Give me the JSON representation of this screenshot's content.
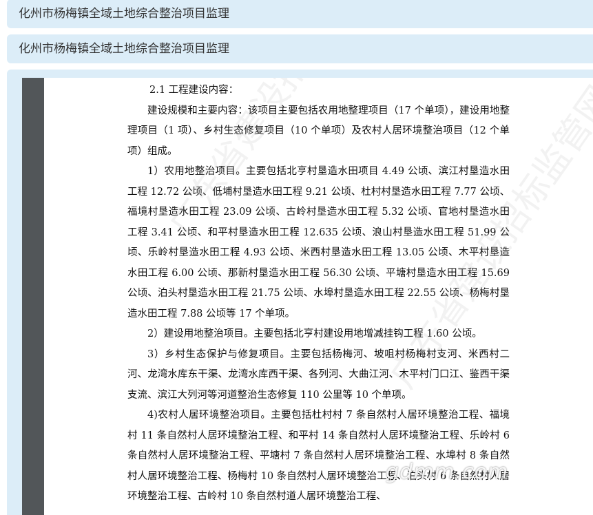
{
  "header": {
    "title_1": "化州市杨梅镇全域土地综合整治项目监理",
    "title_2": "化州市杨梅镇全域土地综合整治项目监理"
  },
  "document": {
    "section_heading": "2.1 工程建设内容：",
    "paragraphs": [
      "建设规模和主要内容：该项目主要包括农用地整理项目（17 个单项），建设用地整理项目（1 项）、乡村生态修复项目（10 个单项）及农村人居环境整治项目（12 个单项）组成。",
      "1）农用地整治项目。主要包括北亨村垦造水田项目 4.49 公顷、滨江村垦造水田工程 12.72 公顷、低埔村垦造水田工程 9.21 公顷、杜村村垦造水田工程 7.77 公顷、福境村垦造水田工程 23.09 公顷、古岭村垦造水田工程 5.32 公顷、官地村垦造水田工程 3.41 公顷、和平村垦造水田工程 12.635 公顷、浪山村垦造水田工程 51.99 公顷、乐岭村垦造水田工程 4.93 公顷、米西村垦造水田工程 13.05 公顷、木平村垦造水田工程 6.00 公顷、那新村垦造水田工程 56.30 公顷、平塘村垦造水田工程 15.69 公顷、泊头村垦造水田工程 21.75 公顷、水埠村垦造水田工程 22.55 公顷、杨梅村垦造水田工程 7.88 公顷等 17 个单项。",
      "2）建设用地整治项目。主要包括北亨村建设用地增减挂钩工程 1.60 公顷。",
      "3）乡村生态保护与修复项目。主要包括杨梅河、坡咀村杨梅村支河、米西村二河、龙湾水库东干渠、龙湾水库西干渠、各列河、大曲江河、木平村门口江、鉴西干渠支流、滨江大列河等河道整治生态修复 110 公里等 10 个单项。",
      "4)农村人居环境整治项目。主要包括杜村村 7 条自然村人居环境整治工程、福境村 11 条自然村人居环境整治工程、和平村 14 条自然村人居环境整治工程、乐岭村 6 条自然村人居环境整治工程、平塘村 7 条自然村人居环境整治工程、水埠村 8 条自然村人居环境整治工程、杨梅村 10 条自然村人居环境整治工程、泊头村 6 条自然村人居环境整治工程、古岭村 10 条自然村道人居环境整治工程、"
    ]
  },
  "watermark": {
    "text": "广东省建设招标监管网",
    "site": "gdmm.com"
  }
}
